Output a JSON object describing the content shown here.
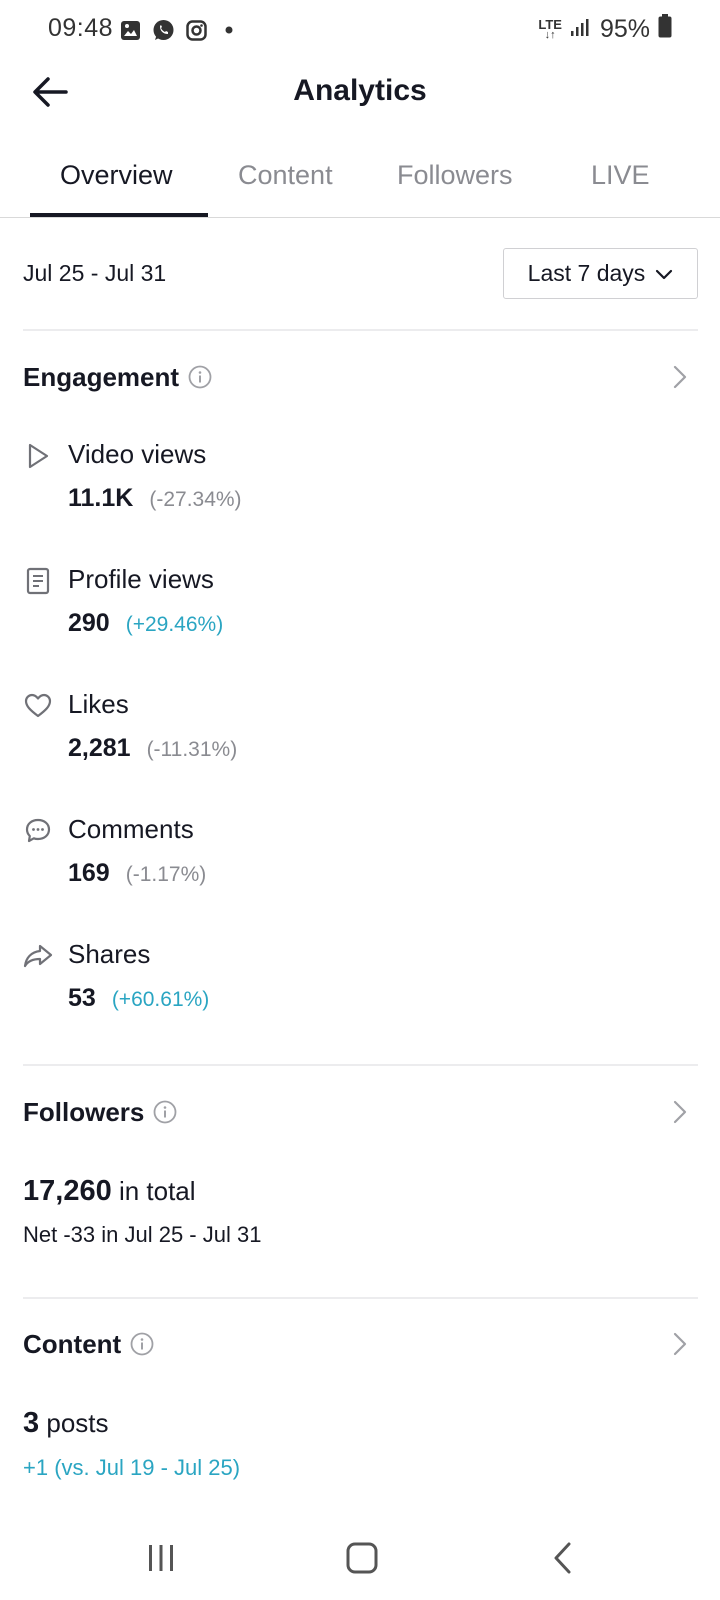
{
  "status_bar": {
    "time": "09:48",
    "network": "LTE",
    "battery": "95%",
    "left_icons": [
      "gallery-icon",
      "whatsapp-icon",
      "instagram-icon",
      "dot-icon"
    ],
    "right_icons": [
      "lte-icon",
      "signal-icon",
      "battery-icon"
    ]
  },
  "header": {
    "title": "Analytics",
    "back_icon": "arrow-left-icon"
  },
  "tabs": [
    {
      "label": "Overview",
      "active": true
    },
    {
      "label": "Content",
      "active": false
    },
    {
      "label": "Followers",
      "active": false
    },
    {
      "label": "LIVE",
      "active": false
    }
  ],
  "date_range": {
    "label": "Jul 25 - Jul 31",
    "selector_value": "Last 7 days"
  },
  "engagement": {
    "title": "Engagement",
    "metrics": [
      {
        "icon": "play-icon",
        "label": "Video views",
        "value": "11.1K",
        "change": "(-27.34%)",
        "trend": "negative"
      },
      {
        "icon": "profile-card-icon",
        "label": "Profile views",
        "value": "290",
        "change": "(+29.46%)",
        "trend": "positive"
      },
      {
        "icon": "heart-icon",
        "label": "Likes",
        "value": "2,281",
        "change": "(-11.31%)",
        "trend": "negative"
      },
      {
        "icon": "comment-icon",
        "label": "Comments",
        "value": "169",
        "change": "(-1.17%)",
        "trend": "negative"
      },
      {
        "icon": "share-icon",
        "label": "Shares",
        "value": "53",
        "change": "(+60.61%)",
        "trend": "positive"
      }
    ]
  },
  "followers": {
    "title": "Followers",
    "total": "17,260",
    "total_suffix": "in total",
    "net": "Net -33 in Jul 25 - Jul 31"
  },
  "content": {
    "title": "Content",
    "posts": "3",
    "posts_suffix": "posts",
    "comparison": "+1 (vs. Jul 19 - Jul 25)"
  },
  "nav": {
    "buttons": [
      "recent-apps-icon",
      "home-icon",
      "back-icon"
    ]
  },
  "colors": {
    "text": "#161823",
    "muted": "#8a8b91",
    "positive": "#2aa5c2",
    "divider": "#ececee"
  }
}
